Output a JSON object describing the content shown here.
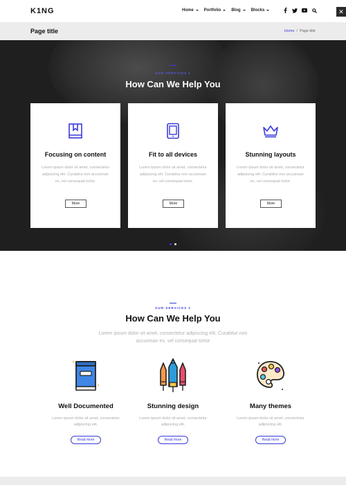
{
  "header": {
    "logo": "K1NG",
    "nav": [
      {
        "label": "Home"
      },
      {
        "label": "Portfolio"
      },
      {
        "label": "Blog"
      },
      {
        "label": "Blocks"
      }
    ],
    "social_icons": [
      "facebook-icon",
      "twitter-icon",
      "youtube-icon",
      "search-icon"
    ],
    "close_glyph": "✕"
  },
  "title_bar": {
    "title": "Page title",
    "breadcrumb": {
      "home": "Home",
      "separator": "/",
      "current": "Page title"
    }
  },
  "hero": {
    "eyebrow": "OUR SERVICES 1",
    "heading": "How Can We Help You",
    "cards": [
      {
        "icon": "bookmark-book-icon",
        "title": "Focusing on content",
        "text": "Lorem ipsum dolor sit amet, consectetur adipiscing elit. Curabitur non accumsan ex, vel consequat tortor.",
        "button": "More"
      },
      {
        "icon": "tablet-icon",
        "title": "Fit to all devices",
        "text": "Lorem ipsum dolor sit amet, consectetur adipiscing elit. Curabitur non accumsan ex, vel consequat tortor.",
        "button": "More"
      },
      {
        "icon": "crown-icon",
        "title": "Stunning layouts",
        "text": "Lorem ipsum dolor sit amet, consectetur adipiscing elit. Curabitur non accumsan ex, vel consequat tortor.",
        "button": "More"
      }
    ],
    "slider_dots": 2,
    "active_dot": 0
  },
  "services2": {
    "eyebrow": "OUR SERVICES 2",
    "heading": "How Can We Help You",
    "lead": "Lorem ipsum dolor sit amet, consectetur adipiscing elit. Curabitur non accumsan ex, vel consequat tortor",
    "features": [
      {
        "icon": "book-illustration-icon",
        "title": "Well Documented",
        "text": "Lorem ipsum dolor sit amet, consectetur adipiscing elit.",
        "button": "Read more"
      },
      {
        "icon": "pencils-illustration-icon",
        "title": "Stunning design",
        "text": "Lorem ipsum dolor sit amet, consectetur adipiscing elit.",
        "button": "Read more"
      },
      {
        "icon": "palette-illustration-icon",
        "title": "Many themes",
        "text": "Lorem ipsum dolor sit amet, consectetur adipiscing elit.",
        "button": "Read more"
      }
    ]
  },
  "colors": {
    "accent": "#3a3adb",
    "hero_bg": "#262626",
    "title_bar_bg": "#ececec"
  }
}
